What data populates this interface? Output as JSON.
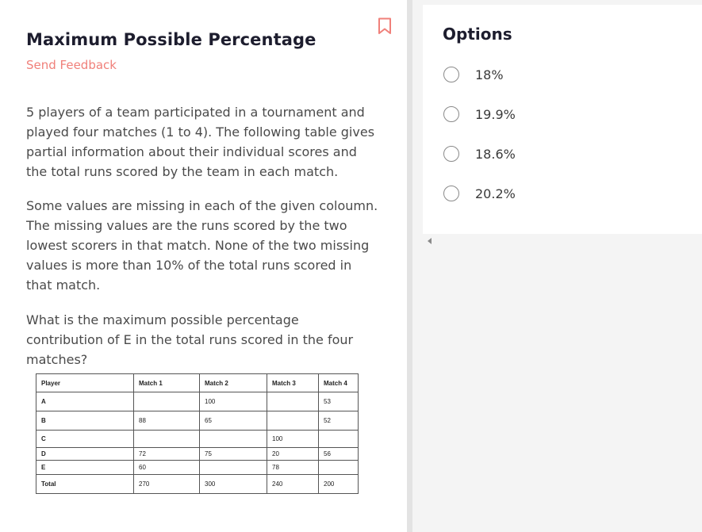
{
  "question": {
    "title": "Maximum Possible Percentage",
    "feedback_link": "Send Feedback",
    "bookmark_icon": "bookmark-icon",
    "paragraphs": [
      "5 players of a team participated in a tournament and played four matches (1 to 4). The following table gives partial information about their individual scores and the total runs scored by the team in each match.",
      "Some values are missing in each of the given coloumn. The missing values are the runs scored by the two lowest scorers in that match. None of the two missing values is more than 10% of the total runs scored in that match.",
      "What is the maximum possible percentage contribution of E in the total runs scored in the four matches?"
    ],
    "table": {
      "headers": [
        "Player",
        "Match 1",
        "Match 2",
        "Match 3",
        "Match 4"
      ],
      "rows": [
        [
          "A",
          "",
          "100",
          "",
          "53"
        ],
        [
          "B",
          "88",
          "65",
          "",
          "52"
        ],
        [
          "C",
          "",
          "",
          "100",
          ""
        ],
        [
          "D",
          "72",
          "75",
          "20",
          "56"
        ],
        [
          "E",
          "60",
          "",
          "78",
          ""
        ],
        [
          "Total",
          "270",
          "300",
          "240",
          "200"
        ]
      ]
    }
  },
  "options": {
    "title": "Options",
    "items": [
      {
        "label": "18%"
      },
      {
        "label": "19.9%"
      },
      {
        "label": "18.6%"
      },
      {
        "label": "20.2%"
      }
    ]
  },
  "colors": {
    "feedback": "#f0807a",
    "bookmark": "#f0807a",
    "title": "#1d1d2e"
  }
}
